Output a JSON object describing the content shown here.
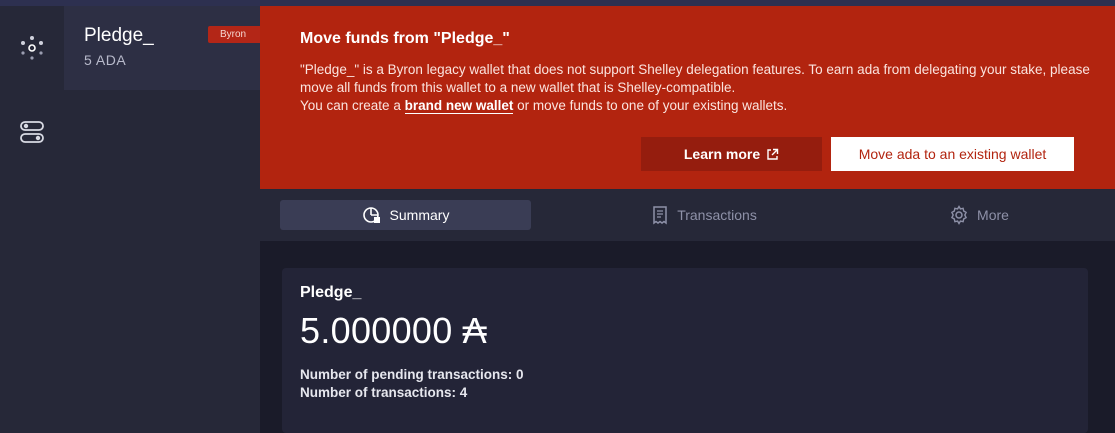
{
  "sidebar": {
    "wallets": [
      {
        "name": "Pledge_",
        "amount": "5 ADA",
        "tag": "Byron"
      }
    ]
  },
  "notice": {
    "title": "Move funds from \"Pledge_\"",
    "body_line1": "\"Pledge_\" is a Byron legacy wallet that does not support Shelley delegation features. To earn ada from delegating your stake, please move all funds from this wallet to a new wallet that is Shelley-compatible.",
    "body_line2_prefix": "You can create a ",
    "body_line2_link": "brand new wallet",
    "body_line2_suffix": " or move funds to one of your existing wallets.",
    "learn_more": "Learn more",
    "move_button": "Move ada to an existing wallet"
  },
  "tabs": [
    {
      "label": "Summary",
      "icon": "summary-icon",
      "active": true
    },
    {
      "label": "Transactions",
      "icon": "transactions-icon",
      "active": false
    },
    {
      "label": "More",
      "icon": "gear-icon",
      "active": false
    }
  ],
  "summary": {
    "wallet_name": "Pledge_",
    "amount": "5.000000",
    "currency_symbol": "₳",
    "pending_tx": "Number of pending transactions: 0",
    "tx_count": "Number of transactions: 4"
  },
  "colors": {
    "notice_bg": "#b2240f",
    "learn_more_bg": "#951d0e",
    "byron_tag": "#b32617",
    "background": "#1a1b29"
  }
}
